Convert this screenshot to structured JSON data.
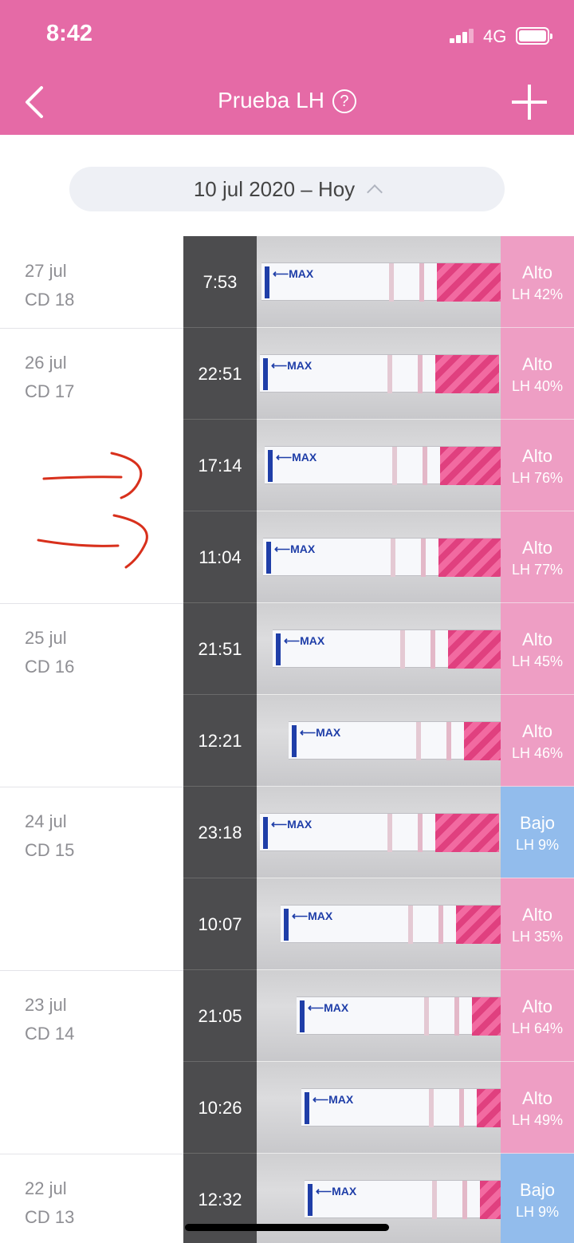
{
  "status_bar": {
    "time": "8:42",
    "network": "4G"
  },
  "nav": {
    "title": "Prueba LH",
    "help_symbol": "?",
    "back_icon": "chevron-left-icon",
    "add_icon": "plus-icon"
  },
  "date_picker": {
    "label": "10 jul 2020 – Hoy"
  },
  "colors": {
    "header": "#e56aa6",
    "alto": "#ee9ec4",
    "bajo": "#92bcec"
  },
  "entries": [
    {
      "date": "27 jul",
      "cycle_day": "CD 18",
      "time": "7:53",
      "level": "Alto",
      "lh": "LH 42%"
    },
    {
      "date": "26 jul",
      "cycle_day": "CD 17",
      "time": "22:51",
      "level": "Alto",
      "lh": "LH 40%"
    },
    {
      "date": "",
      "cycle_day": "",
      "time": "17:14",
      "level": "Alto",
      "lh": "LH 76%"
    },
    {
      "date": "",
      "cycle_day": "",
      "time": "11:04",
      "level": "Alto",
      "lh": "LH 77%"
    },
    {
      "date": "25 jul",
      "cycle_day": "CD 16",
      "time": "21:51",
      "level": "Alto",
      "lh": "LH 45%"
    },
    {
      "date": "",
      "cycle_day": "",
      "time": "12:21",
      "level": "Alto",
      "lh": "LH 46%"
    },
    {
      "date": "24 jul",
      "cycle_day": "CD 15",
      "time": "23:18",
      "level": "Bajo",
      "lh": "LH 9%"
    },
    {
      "date": "",
      "cycle_day": "",
      "time": "10:07",
      "level": "Alto",
      "lh": "LH 35%"
    },
    {
      "date": "23 jul",
      "cycle_day": "CD 14",
      "time": "21:05",
      "level": "Alto",
      "lh": "LH 64%"
    },
    {
      "date": "",
      "cycle_day": "",
      "time": "10:26",
      "level": "Alto",
      "lh": "LH 49%"
    },
    {
      "date": "22 jul",
      "cycle_day": "CD 13",
      "time": "12:32",
      "level": "Bajo",
      "lh": "LH 9%"
    }
  ],
  "strip_text": "⟵MAX"
}
